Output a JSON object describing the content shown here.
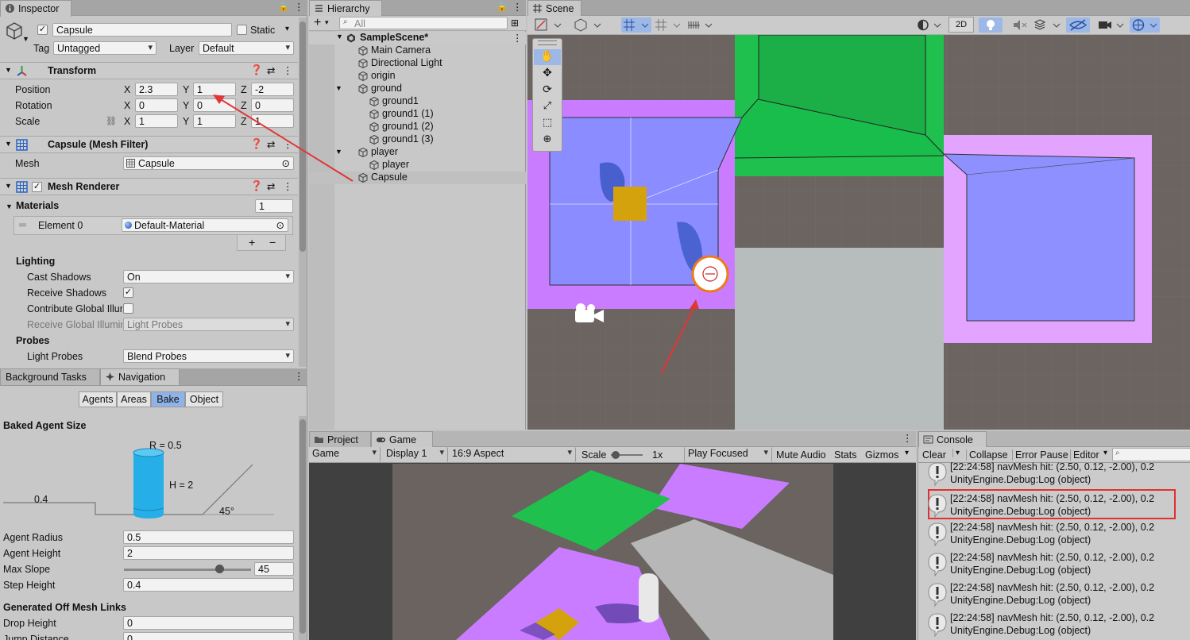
{
  "inspector": {
    "tab": "Inspector",
    "object_name": "Capsule",
    "static_label": "Static",
    "tag_label": "Tag",
    "tag_value": "Untagged",
    "layer_label": "Layer",
    "layer_value": "Default",
    "transform": {
      "title": "Transform",
      "position_label": "Position",
      "rotation_label": "Rotation",
      "scale_label": "Scale",
      "x": "X",
      "y": "Y",
      "z": "Z",
      "position": [
        "2.3",
        "1",
        "-2"
      ],
      "rotation": [
        "0",
        "0",
        "0"
      ],
      "scale": [
        "1",
        "1",
        "1"
      ]
    },
    "mesh_filter": {
      "title": "Capsule (Mesh Filter)",
      "mesh_label": "Mesh",
      "mesh_value": "Capsule"
    },
    "mesh_renderer": {
      "title": "Mesh Renderer",
      "materials_label": "Materials",
      "materials_count": "1",
      "element_label": "Element 0",
      "element_value": "Default-Material",
      "plus": "+",
      "minus": "−",
      "lighting_label": "Lighting",
      "cast_shadows_label": "Cast Shadows",
      "cast_shadows_value": "On",
      "receive_shadows_label": "Receive Shadows",
      "contribute_gi_label": "Contribute Global Illumi",
      "receive_gi_label": "Receive Global Illumin",
      "receive_gi_value": "Light Probes",
      "probes_label": "Probes",
      "light_probes_label": "Light Probes",
      "light_probes_value": "Blend Probes"
    }
  },
  "navigation": {
    "tabs": [
      "Background Tasks",
      "Navigation"
    ],
    "buttons": [
      "Agents",
      "Areas",
      "Bake",
      "Object"
    ],
    "baked_agent_size": "Baked Agent Size",
    "diagram": {
      "r": "R = 0.5",
      "h": "H = 2",
      "step": "0.4",
      "angle": "45°"
    },
    "agent_radius_label": "Agent Radius",
    "agent_radius": "0.5",
    "agent_height_label": "Agent Height",
    "agent_height": "2",
    "max_slope_label": "Max Slope",
    "max_slope": "45",
    "max_slope_fraction": 0.75,
    "step_height_label": "Step Height",
    "step_height": "0.4",
    "offmesh_label": "Generated Off Mesh Links",
    "drop_height_label": "Drop Height",
    "drop_height": "0",
    "jump_distance_label": "Jump Distance",
    "jump_distance": "0"
  },
  "hierarchy": {
    "tab": "Hierarchy",
    "search_placeholder": "All",
    "add": "+",
    "scene": "SampleScene*",
    "items": [
      "Main Camera",
      "Directional Light",
      "origin",
      "ground",
      "ground1",
      "ground1 (1)",
      "ground1 (2)",
      "ground1 (3)",
      "player",
      "player",
      "Capsule"
    ]
  },
  "scene": {
    "tab": "Scene",
    "btn_2d": "2D"
  },
  "game": {
    "tabs": [
      "Project",
      "Game"
    ],
    "display_mode": "Game",
    "display": "Display 1",
    "aspect": "16:9 Aspect",
    "scale_label": "Scale",
    "scale_value": "1x",
    "play_focused": "Play Focused",
    "mute_audio": "Mute Audio",
    "stats": "Stats",
    "gizmos": "Gizmos"
  },
  "console": {
    "tab": "Console",
    "clear": "Clear",
    "collapse": "Collapse",
    "error_pause": "Error Pause",
    "editor": "Editor",
    "entries": [
      {
        "line1": "[22:24:58] navMesh hit: (2.50, 0.12, -2.00), 0.2",
        "line2": "UnityEngine.Debug:Log (object)"
      },
      {
        "line1": "[22:24:58] navMesh hit: (2.50, 0.12, -2.00), 0.2",
        "line2": "UnityEngine.Debug:Log (object)"
      },
      {
        "line1": "[22:24:58] navMesh hit: (2.50, 0.12, -2.00), 0.2",
        "line2": "UnityEngine.Debug:Log (object)"
      },
      {
        "line1": "[22:24:58] navMesh hit: (2.50, 0.12, -2.00), 0.2",
        "line2": "UnityEngine.Debug:Log (object)"
      },
      {
        "line1": "[22:24:58] navMesh hit: (2.50, 0.12, -2.00), 0.2",
        "line2": "UnityEngine.Debug:Log (object)"
      },
      {
        "line1": "[22:24:58] navMesh hit: (2.50, 0.12, -2.00), 0.2",
        "line2": "UnityEngine.Debug:Log (object)"
      }
    ]
  },
  "colors": {
    "selection": "#c6c6c6",
    "navmesh_blue": "#8a8cff",
    "purple": "#c97cff",
    "green": "#1fc04e",
    "highlight_red": "#e03030"
  }
}
